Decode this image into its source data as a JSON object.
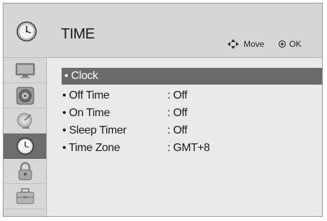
{
  "header": {
    "title": "TIME",
    "move_hint": "Move",
    "ok_hint": "OK"
  },
  "sidebar": {
    "items": [
      {
        "name": "picture",
        "icon": "monitor-icon"
      },
      {
        "name": "sound",
        "icon": "speaker-icon"
      },
      {
        "name": "channel",
        "icon": "satellite-dish-icon"
      },
      {
        "name": "time",
        "icon": "clock-icon",
        "active": true
      },
      {
        "name": "lock",
        "icon": "lock-icon"
      },
      {
        "name": "setup",
        "icon": "toolbox-icon"
      }
    ]
  },
  "menu": {
    "items": [
      {
        "label": "• Clock",
        "value": ""
      },
      {
        "label": "• Off Time",
        "value": ": Off"
      },
      {
        "label": "• On Time",
        "value": ": Off"
      },
      {
        "label": "• Sleep Timer",
        "value": ": Off"
      },
      {
        "label": "• Time Zone",
        "value": ": GMT+8"
      }
    ]
  },
  "colors": {
    "header_bg": "#d6d6d6",
    "panel_bg": "#eaeaea",
    "selection_bg": "#6a6a6a",
    "active_sidebar_bg": "#6e6e6e"
  }
}
